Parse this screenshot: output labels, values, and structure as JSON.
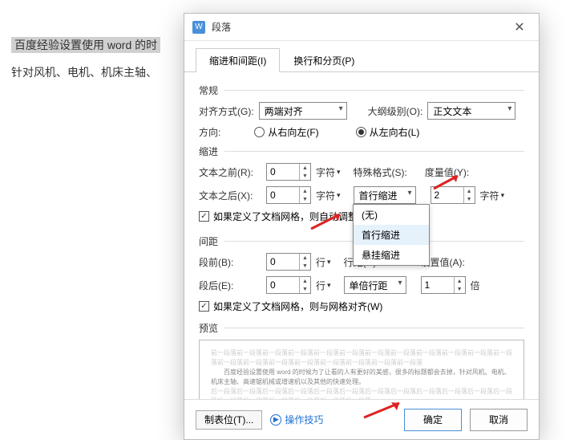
{
  "background": {
    "line1": "百度经验设置使用 word 的时",
    "line2": "针对风机、电机、机床主轴、"
  },
  "dialog": {
    "title": "段落",
    "tabs": {
      "indent_spacing": "缩进和间距(I)",
      "line_page_breaks": "换行和分页(P)"
    },
    "general": {
      "title": "常规",
      "alignment_label": "对齐方式(G):",
      "alignment_value": "两端对齐",
      "outline_label": "大纲级别(O):",
      "outline_value": "正文文本",
      "direction_label": "方向:",
      "rtl_label": "从右向左(F)",
      "ltr_label": "从左向右(L)"
    },
    "indent": {
      "title": "缩进",
      "before_label": "文本之前(R):",
      "before_value": "0",
      "after_label": "文本之后(X):",
      "after_value": "0",
      "char_unit": "字符",
      "special_label": "特殊格式(S):",
      "special_value": "首行缩进",
      "measure_label": "度量值(Y):",
      "measure_value": "2",
      "measure_unit": "字符",
      "options": {
        "none": "(无)",
        "first": "首行缩进",
        "hanging": "悬挂缩进"
      },
      "auto_adjust": "如果定义了文档网格，则自动调整"
    },
    "spacing": {
      "title": "间距",
      "before_label": "段前(B):",
      "before_value": "0",
      "after_label": "段后(E):",
      "after_value": "0",
      "line_unit": "行",
      "linespacing_label": "行距(N):",
      "linespacing_value": "单倍行距",
      "setvalue_label": "设置值(A):",
      "setvalue_value": "1",
      "setvalue_unit": "倍",
      "snap_grid": "如果定义了文档网格，则与网格对齐(W)"
    },
    "preview": {
      "title": "预览",
      "ghost_before": "前一段落前一段落前一段落前一段落前一段落前一段落前一段落前一段落前一段落前一段落前一段落前一段落前一段落前一段落前一段落前一段落前一段落前一段落前一段落前一段落",
      "sample": "百度经验设置使用 word 的时候为了让看的人有更好的美感，很多的标题都会去掉，针对风机、电机、机床主轴、高速锯机械或增速机以及其他的快速处理。",
      "ghost_after": "后一段落后一段落后一段落后一段落后一段落后一段落后一段落后一段落后一段落后一段落后一段落后一段落后一段落后一段落后一段落后一段落后一段落后一段落"
    },
    "footer": {
      "tabstops": "制表位(T)...",
      "tips": "操作技巧",
      "ok": "确定",
      "cancel": "取消"
    }
  }
}
